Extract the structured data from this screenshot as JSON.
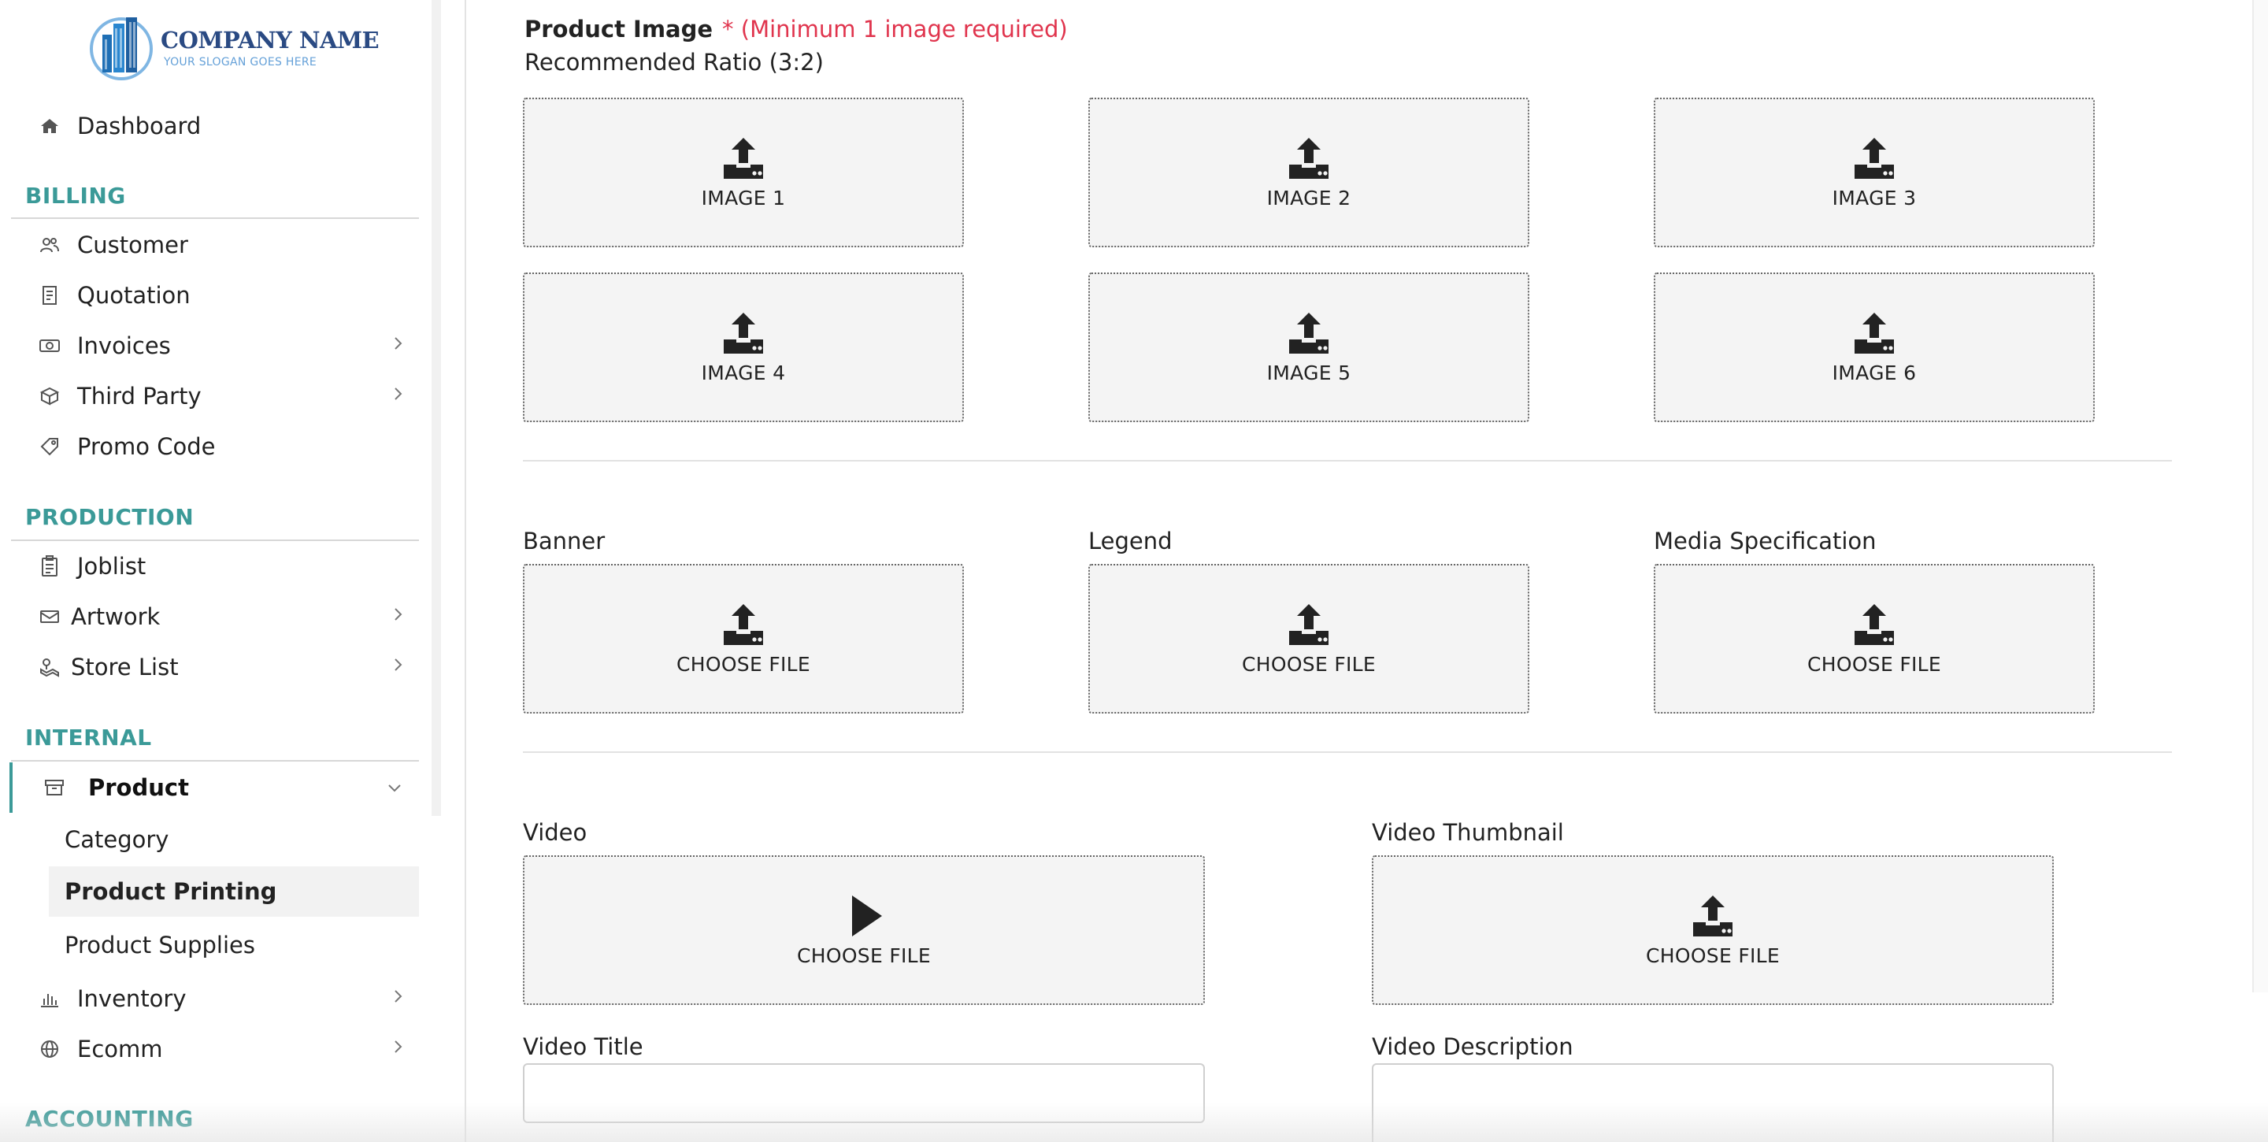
{
  "brand": {
    "name": "COMPANY NAME",
    "slogan": "YOUR SLOGAN GOES HERE",
    "accent_color": "#3b9a98",
    "logo_color": "#2a4a83"
  },
  "sidebar": {
    "dashboard": {
      "label": "Dashboard",
      "icon": "home-icon"
    },
    "sections": {
      "billing": {
        "title": "BILLING",
        "items": [
          {
            "label": "Customer",
            "icon": "users-icon"
          },
          {
            "label": "Quotation",
            "icon": "receipt-icon"
          },
          {
            "label": "Invoices",
            "icon": "money-icon"
          },
          {
            "label": "Third Party",
            "icon": "box-icon"
          },
          {
            "label": "Promo Code",
            "icon": "tag-icon"
          }
        ]
      },
      "production": {
        "title": "PRODUCTION",
        "items": [
          {
            "label": "Joblist",
            "icon": "clipboard-icon"
          },
          {
            "label": "Artwork",
            "icon": "envelope-icon"
          },
          {
            "label": "Store List",
            "icon": "map-icon"
          }
        ]
      },
      "internal": {
        "title": "INTERNAL",
        "product": {
          "label": "Product",
          "icon": "archive-icon"
        },
        "sub_items": [
          {
            "label": "Category"
          },
          {
            "label": "Product Printing"
          },
          {
            "label": "Product Supplies"
          }
        ],
        "items": [
          {
            "label": "Inventory",
            "icon": "bar-chart-icon"
          },
          {
            "label": "Ecomm",
            "icon": "globe-icon"
          }
        ]
      },
      "accounting": {
        "title": "ACCOUNTING"
      }
    }
  },
  "main": {
    "product_image": {
      "title": "Product Image",
      "required_note": "* (Minimum 1 image required)",
      "ratio_note": "Recommended Ratio (3:2)",
      "images": [
        "IMAGE 1",
        "IMAGE 2",
        "IMAGE 3",
        "IMAGE 4",
        "IMAGE 5",
        "IMAGE 6"
      ]
    },
    "files": {
      "banner": {
        "label": "Banner",
        "button": "CHOOSE FILE"
      },
      "legend": {
        "label": "Legend",
        "button": "CHOOSE FILE"
      },
      "media_spec": {
        "label": "Media Specification",
        "button": "CHOOSE FILE"
      }
    },
    "video": {
      "video": {
        "label": "Video",
        "button": "CHOOSE FILE"
      },
      "thumbnail": {
        "label": "Video Thumbnail",
        "button": "CHOOSE FILE"
      },
      "title": {
        "label": "Video Title",
        "value": ""
      },
      "description": {
        "label": "Video Description",
        "value": ""
      }
    }
  }
}
